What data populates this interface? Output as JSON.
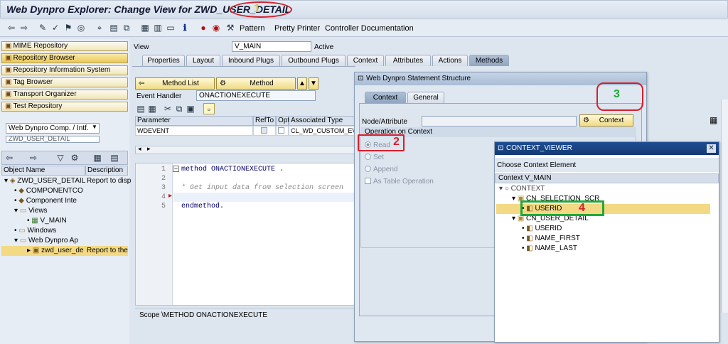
{
  "window": {
    "title": "Web Dynpro Explorer: Change View for ZWD_USER_DETAIL"
  },
  "toolbar": {
    "pattern": "Pattern",
    "pretty_printer": "Pretty Printer",
    "controller_doc": "Controller Documentation"
  },
  "nav": [
    "MIME Repository",
    "Repository Browser",
    "Repository Information System",
    "Tag Browser",
    "Transport Organizer",
    "Test Repository"
  ],
  "object_type": "Web Dynpro Comp. / Intf.",
  "object_name": "ZWD_USER_DETAIL",
  "object_tree": {
    "col_name": "Object Name",
    "col_desc": "Description",
    "rows": [
      {
        "name": "ZWD_USER_DETAIL",
        "desc": "Report to disp"
      },
      {
        "name": "COMPONENTCO",
        "desc": ""
      },
      {
        "name": "Component Inte",
        "desc": ""
      },
      {
        "name": "Views",
        "desc": ""
      },
      {
        "name": "V_MAIN",
        "desc": ""
      },
      {
        "name": "Windows",
        "desc": ""
      },
      {
        "name": "Web Dynpro Ap",
        "desc": ""
      },
      {
        "name": "zwd_user_de",
        "desc": "Report to the"
      }
    ]
  },
  "view": {
    "label": "View",
    "value": "V_MAIN",
    "status": "Active"
  },
  "tabs": [
    "Properties",
    "Layout",
    "Inbound Plugs",
    "Outbound Plugs",
    "Context",
    "Attributes",
    "Actions",
    "Methods"
  ],
  "method_editor": {
    "method_list": "Method List",
    "method": "Method",
    "event_handler_label": "Event Handler",
    "event_handler_value": "ONACTIONEXECUTE",
    "param_headers": [
      "Parameter",
      "RefTo",
      "Opt",
      "Associated Type"
    ],
    "param_row": {
      "name": "WDEVENT",
      "type": "CL_WD_CUSTOM_EVEN"
    },
    "line_numbers": [
      "1",
      "2",
      "3",
      "4",
      "5"
    ],
    "code": [
      "method ONACTIONEXECUTE .",
      "",
      "* Get input data from selection screen",
      "",
      "endmethod."
    ],
    "scope": "Scope \\METHOD ONACTIONEXECUTE"
  },
  "statement_dialog": {
    "title": "Web Dynpro Statement Structure",
    "tabs": [
      "Context",
      "General"
    ],
    "node_label": "Node/Attribute",
    "context_btn": "Context",
    "operation_header": "Operation on Context",
    "options": [
      "Read",
      "Set",
      "Append",
      "As Table Operation"
    ]
  },
  "context_viewer": {
    "title": "CONTEXT_VIEWER",
    "choose": "Choose Context Element",
    "header": "Context V_MAIN",
    "nodes": [
      "CONTEXT",
      "CN_SELECTION_SCR",
      "USERID",
      "CN_USER_DETAIL",
      "USERID",
      "NAME_FIRST",
      "NAME_LAST"
    ]
  },
  "annotations": [
    "1",
    "2",
    "3",
    "4"
  ],
  "colors": {
    "red": "#d4202c",
    "green": "#20a83a",
    "yellow_btn": "#f1dc85"
  }
}
